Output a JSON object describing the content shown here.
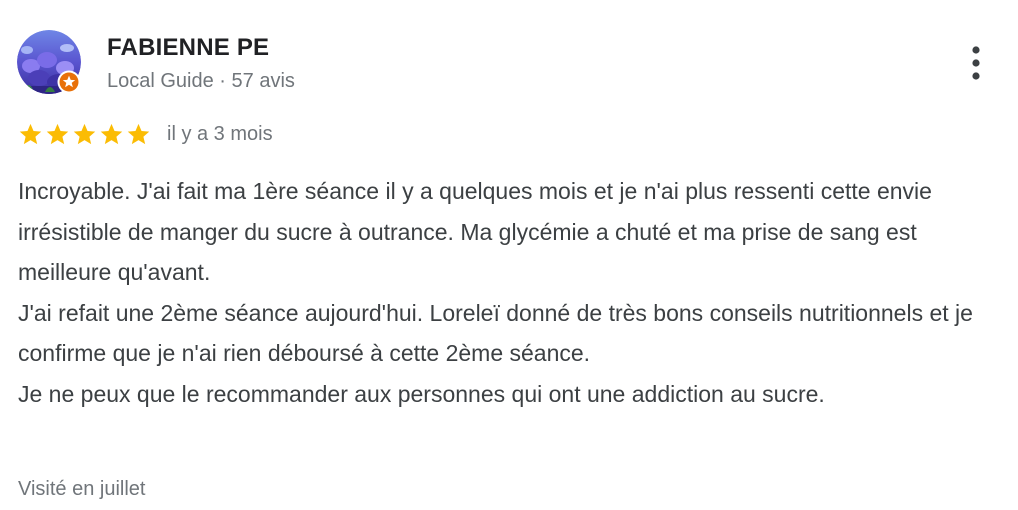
{
  "reviewer": {
    "name": "FABIENNE PE",
    "meta": "Local Guide · 57 avis",
    "avatar_icon": "avatar-photo-purple-flowers",
    "badge_icon": "local-guide-star-icon"
  },
  "rating": {
    "stars": 5,
    "max_stars": 5,
    "star_color": "#fbbc04",
    "date": "il y a 3 mois"
  },
  "review": {
    "text": "Incroyable. J'ai fait ma 1ère séance il y a quelques mois et je n'ai plus ressenti cette envie irrésistible de manger du sucre à outrance. Ma glycémie a chuté et ma prise de sang est meilleure qu'avant.\nJ'ai refait une 2ème séance aujourd'hui. Loreleï donné de très bons conseils nutritionnels et je confirme que je n'ai rien déboursé à cette 2ème séance.\nJe ne peux que le recommander aux personnes qui ont une addiction au sucre."
  },
  "visit": {
    "label": "Visité en juillet"
  },
  "actions": {
    "more_icon": "more-vertical-icon"
  },
  "colors": {
    "name": "#202124",
    "meta": "#70757a",
    "body": "#3c4043",
    "badge": "#e8710a"
  }
}
